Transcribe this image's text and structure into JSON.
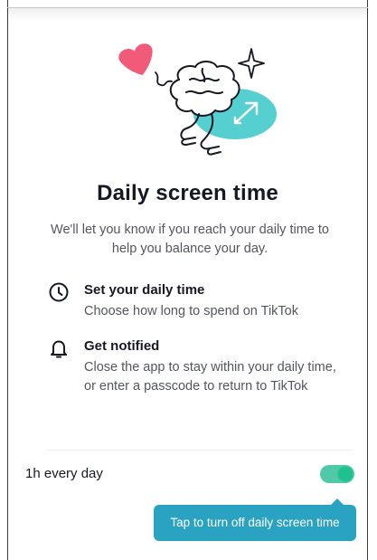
{
  "header": {
    "title": "Daily screen time",
    "subtitle": "We'll let you know if you reach your daily time to help you balance your day."
  },
  "features": [
    {
      "icon": "clock-icon",
      "title": "Set your daily time",
      "description": "Choose how long to spend on TikTok"
    },
    {
      "icon": "bell-icon",
      "title": "Get notified",
      "description": "Close the app to stay within your daily time, or enter a passcode to return to TikTok"
    }
  ],
  "setting": {
    "label": "1h every day",
    "toggle_on": true
  },
  "tooltip": {
    "text": "Tap to turn off daily screen time"
  },
  "colors": {
    "title_text": "#161823",
    "secondary_text": "#545660",
    "toggle_track": "#4fc9a8",
    "toggle_knob": "#20c08f",
    "tooltip_bg": "#2aa3c2",
    "heart": "#f15b79",
    "accent_teal": "#56cfd1"
  }
}
